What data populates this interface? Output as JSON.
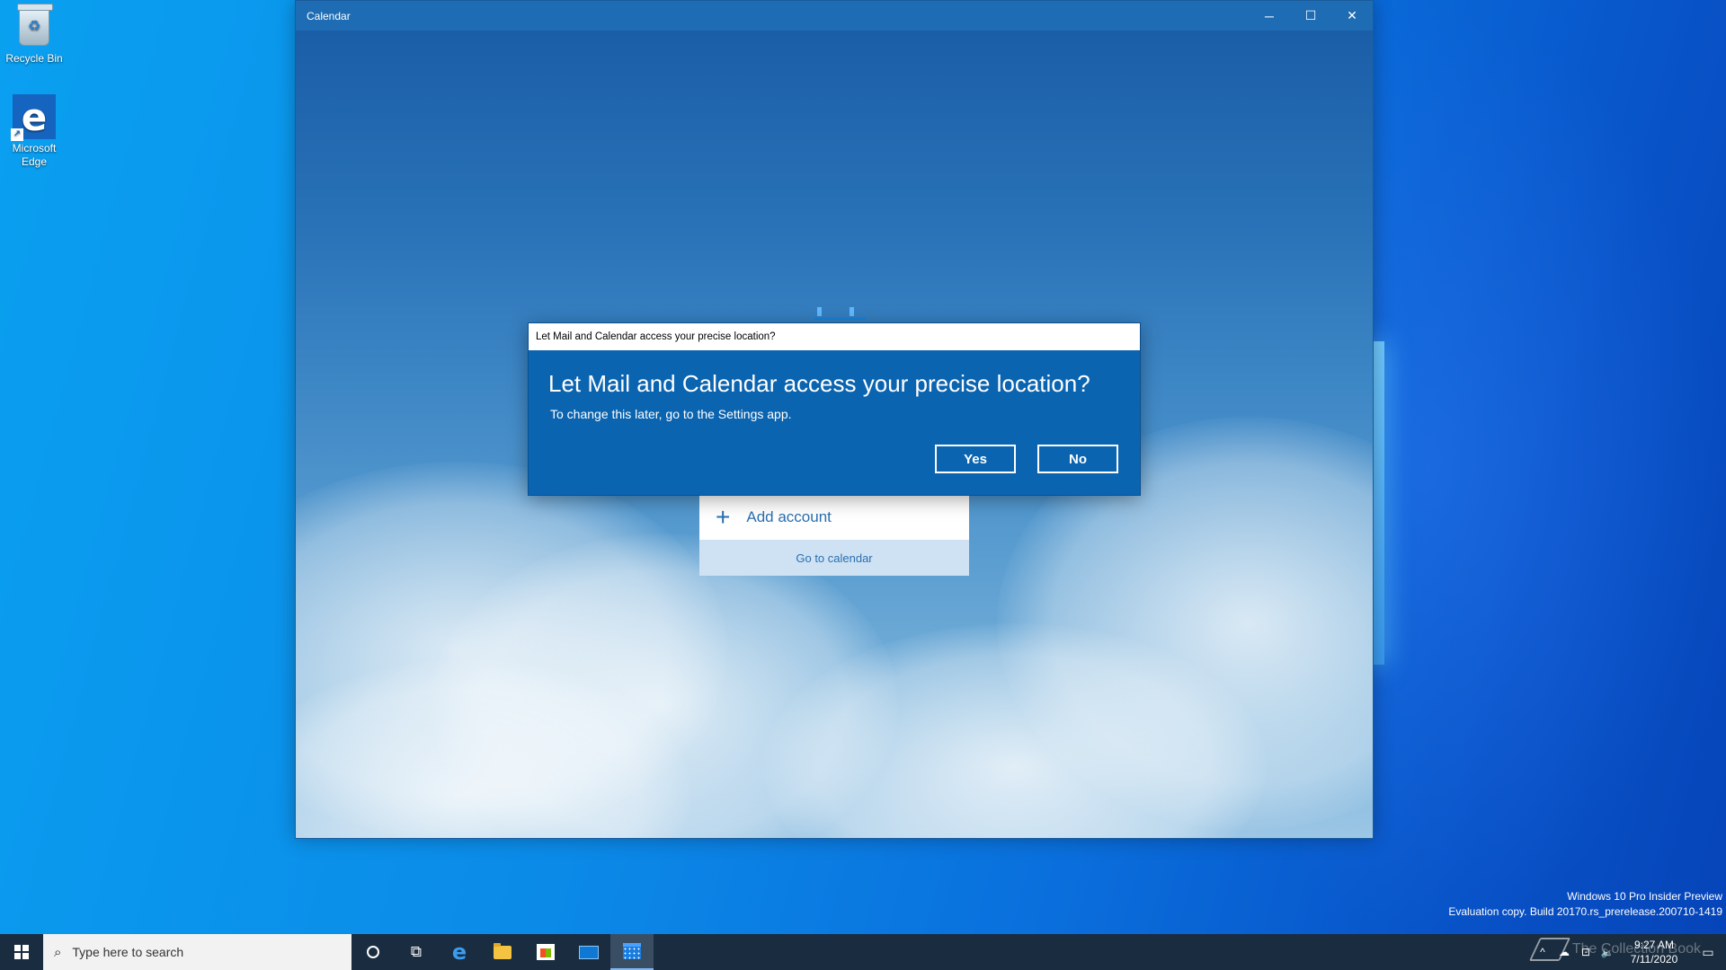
{
  "desktop": {
    "icons": [
      {
        "label": "Recycle Bin",
        "icon": "recycle-bin-icon"
      },
      {
        "label": "Microsoft Edge",
        "icon": "edge-icon"
      }
    ],
    "watermark": {
      "line1": "Windows 10 Pro Insider Preview",
      "line2": "Evaluation copy. Build 20170.rs_prerelease.200710-1419"
    }
  },
  "calendar_window": {
    "title": "Calendar",
    "controls": {
      "minimize": "─",
      "maximize": "☐",
      "close": "✕"
    },
    "setup": {
      "add_account": "Add account",
      "go_to_calendar": "Go to calendar"
    }
  },
  "dialog": {
    "titlebar": "Let Mail and Calendar access your precise location?",
    "heading": "Let Mail and Calendar access your precise location?",
    "subtext": "To change this later, go to the Settings app.",
    "yes": "Yes",
    "no": "No"
  },
  "taskbar": {
    "search_placeholder": "Type here to search",
    "pinned": [
      "cortana-icon",
      "task-view-icon",
      "edge-icon",
      "file-explorer-icon",
      "store-icon",
      "mail-icon",
      "calendar-icon"
    ],
    "active": "calendar-icon",
    "clock": {
      "time": "9:27 AM",
      "date": "7/11/2020"
    },
    "watermark_brand": "The Collection Book"
  },
  "colors": {
    "titlebar": "#1d6cb4",
    "dialog_bg": "#0b64b0",
    "taskbar": "#1a2c3f",
    "accent": "#2a6fb0"
  }
}
